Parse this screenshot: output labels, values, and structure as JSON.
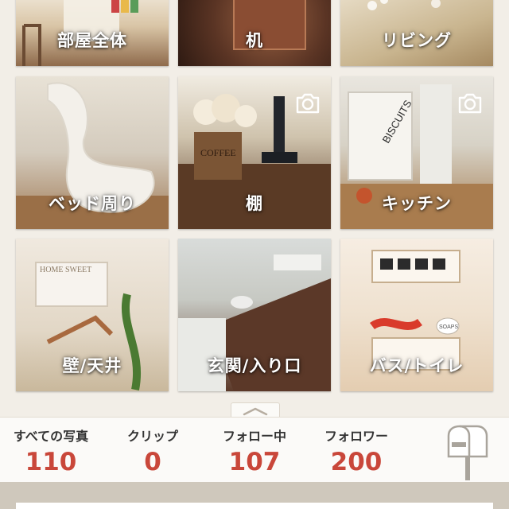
{
  "categories": [
    {
      "label": "部屋全体",
      "has_camera": false
    },
    {
      "label": "机",
      "has_camera": false
    },
    {
      "label": "リビング",
      "has_camera": false
    },
    {
      "label": "ベッド周り",
      "has_camera": false
    },
    {
      "label": "棚",
      "has_camera": true
    },
    {
      "label": "キッチン",
      "has_camera": true
    },
    {
      "label": "壁/天井",
      "has_camera": false
    },
    {
      "label": "玄関/入り口",
      "has_camera": false
    },
    {
      "label": "バス/トイレ",
      "has_camera": false
    }
  ],
  "stats": {
    "all_photos": {
      "label": "すべての写真",
      "value": "110"
    },
    "clips": {
      "label": "クリップ",
      "value": "0"
    },
    "following": {
      "label": "フォロー中",
      "value": "107"
    },
    "followers": {
      "label": "フォロワー",
      "value": "200"
    }
  },
  "icons": {
    "camera": "camera-icon",
    "collapse": "chevron-up-icon",
    "mailbox": "mailbox-icon"
  },
  "colors": {
    "accent_number": "#c9473a",
    "background": "#f2eee7"
  },
  "photo_text": {
    "kitchen_tin": "BISCUITS",
    "shelf_bin": "COFFEE",
    "wall_rack": "HOME SWEET",
    "bath_tin": "SOAPS"
  }
}
